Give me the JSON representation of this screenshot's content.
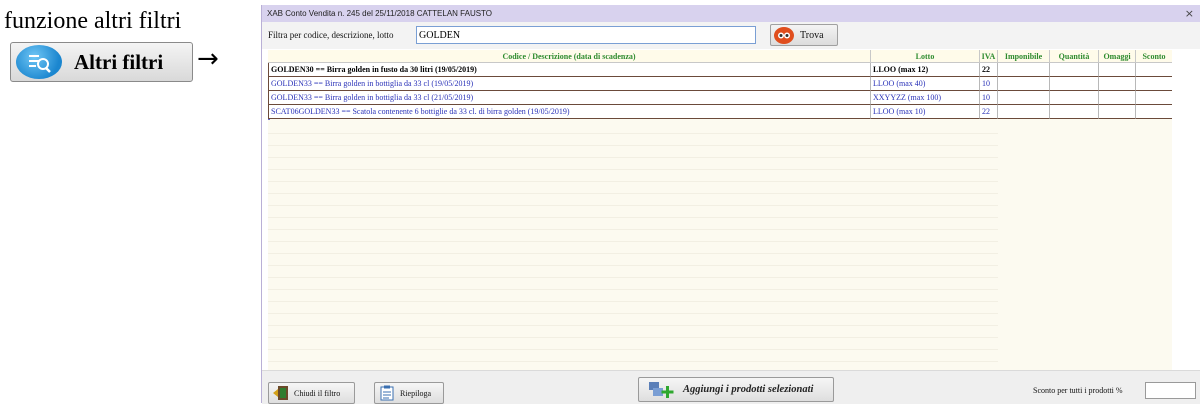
{
  "annotation": {
    "title": "funzione altri filtri",
    "button_label": "Altri filtri",
    "arrow": "→"
  },
  "window": {
    "title": "XAB Conto Vendita n. 245 del 25/11/2018 CATTELAN FAUSTO",
    "close": "×"
  },
  "filter": {
    "label": "Filtra per codice, descrizione, lotto",
    "value": "GOLDEN",
    "search_button": "Trova"
  },
  "table": {
    "headers": {
      "desc": "Codice / Descrizione (data di scadenza)",
      "lotto": "Lotto",
      "iva": "IVA",
      "imponibile": "Imponibile",
      "quantita": "Quantità",
      "omaggi": "Omaggi",
      "sconto": "Sconto"
    },
    "rows": [
      {
        "desc": "GOLDEN30 == Birra golden in fusto da 30 litri (19/05/2019)",
        "lotto": "LLOO (max 12)",
        "iva": "22"
      },
      {
        "desc": "GOLDEN33 == Birra golden in bottiglia da 33 cl (19/05/2019)",
        "lotto": "LLOO (max 40)",
        "iva": "10"
      },
      {
        "desc": "GOLDEN33 == Birra golden in bottiglia da 33 cl (21/05/2019)",
        "lotto": "XXYYZZ (max 100)",
        "iva": "10"
      },
      {
        "desc": "SCAT06GOLDEN33 == Scatola contenente 6 bottiglie da 33 cl. di birra golden (19/05/2019)",
        "lotto": "LLOO (max 10)",
        "iva": "22"
      }
    ]
  },
  "bottom": {
    "close_filter": "Chiudi il filtro",
    "summary": "Riepiloga",
    "add_selected": "Aggiungi i prodotti selezionati",
    "discount_label": "Sconto per tutti i prodotti %",
    "discount_value": ""
  },
  "colors": {
    "header_text": "#2e8b2e",
    "row_text": "#2a32b8",
    "titlebar": "#d8d2ee"
  }
}
